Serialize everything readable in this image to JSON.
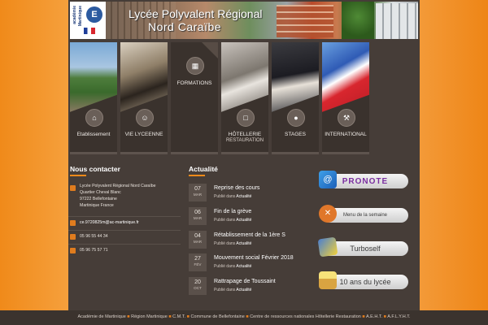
{
  "header": {
    "logo_line1": "académie",
    "logo_line2": "Martinique",
    "logo_letter": "E",
    "title_line1": "Lycée Polyvalent Régional",
    "title_line2": "Nord Caraïbe"
  },
  "nav": {
    "tiles": [
      {
        "label": "Etablissement",
        "sub": "",
        "icon": "home-icon"
      },
      {
        "label": "VIE LYCEENNE",
        "sub": "",
        "icon": "people-icon"
      },
      {
        "label": "FORMATIONS",
        "sub": "",
        "icon": "building-icon"
      },
      {
        "label": "HÔTELLERIE",
        "sub": "RESTAURATION",
        "icon": "book-icon"
      },
      {
        "label": "STAGES",
        "sub": "",
        "icon": "person-icon"
      },
      {
        "label": "INTERNATIONAL",
        "sub": "",
        "icon": "hammer-icon"
      }
    ]
  },
  "contact": {
    "heading": "Nous contacter",
    "address": [
      "Lycée Polyvalent Régional Nord Caraïbe",
      "Quartier Cheval Blanc",
      "97222 Bellefontaine",
      "Martinique France"
    ],
    "email": "ce.9720825m@ac-martinique.fr",
    "phone": "05 96 55 44 34",
    "fax": "05 96 75 57 71"
  },
  "news": {
    "heading": "Actualité",
    "published_prefix": "Publié dans",
    "items": [
      {
        "day": "07",
        "month": "MAR",
        "title": "Reprise des cours",
        "category": "Actualité"
      },
      {
        "day": "06",
        "month": "MAR",
        "title": "Fin de la grève",
        "category": "Actualité"
      },
      {
        "day": "04",
        "month": "MAR",
        "title": "Rétablissement de la 1ère S",
        "category": "Actualité"
      },
      {
        "day": "27",
        "month": "FÉV",
        "title": "Mouvement social Février 2018",
        "category": "Actualité"
      },
      {
        "day": "20",
        "month": "OCT",
        "title": "Rattrapage de Toussaint",
        "category": "Actualité"
      }
    ]
  },
  "quicklinks": {
    "pronote": "PRONOTE",
    "menu": "Menu de la semaine",
    "turboself": "Turboself",
    "anniversary": "10 ans du lycée"
  },
  "footer": {
    "links": [
      "Académie de Martinique",
      "Région Martinique",
      "C.M.T.",
      "Commune de Bellefontaine",
      "Centre de ressources nationales Hôtellerie Restauration",
      "A.E.H.T.",
      "A.F.L.Y.H.T."
    ]
  },
  "colors": {
    "accent": "#f08a1a",
    "panel": "#463d38",
    "tile": "#3a322d"
  }
}
